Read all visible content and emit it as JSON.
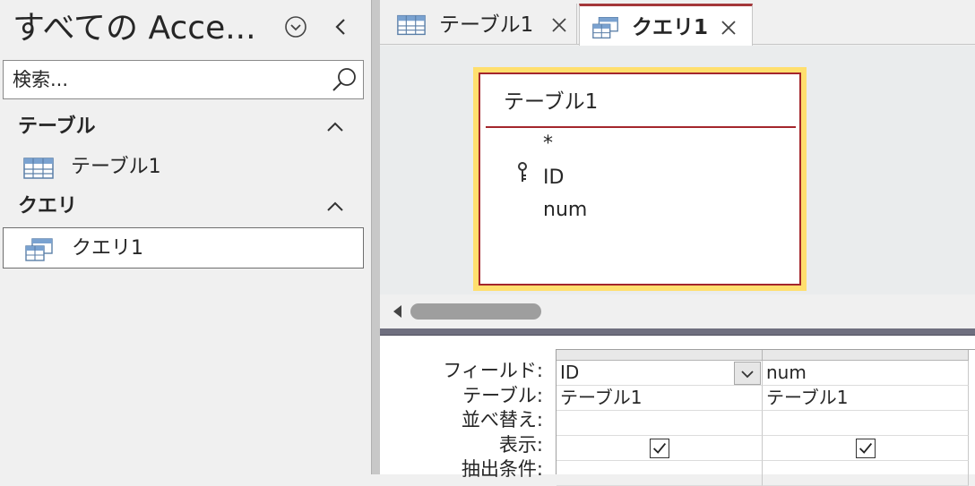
{
  "nav": {
    "title": "すべての Acce...",
    "search_placeholder": "検索...",
    "groups": [
      {
        "label": "テーブル",
        "items": [
          {
            "label": "テーブル1",
            "icon": "table-icon"
          }
        ]
      },
      {
        "label": "クエリ",
        "items": [
          {
            "label": "クエリ1",
            "icon": "query-icon",
            "selected": true
          }
        ]
      }
    ]
  },
  "tabs": [
    {
      "label": "テーブル1",
      "icon": "table-icon",
      "active": false
    },
    {
      "label": "クエリ1",
      "icon": "query-icon",
      "active": true
    }
  ],
  "table_box": {
    "title": "テーブル1",
    "fields": [
      "*",
      "ID",
      "num"
    ]
  },
  "grid": {
    "row_labels": [
      "フィールド:",
      "テーブル:",
      "並べ替え:",
      "表示:",
      "抽出条件:"
    ],
    "columns": [
      {
        "field": "ID",
        "table": "テーブル1",
        "sort": "",
        "show": true
      },
      {
        "field": "num",
        "table": "テーブル1",
        "sort": "",
        "show": true
      }
    ]
  },
  "colors": {
    "accent": "#a4373a",
    "table_border": "#a4262c",
    "selection_outline": "#ffdf6e",
    "splitter_bar": "#6f6f7f"
  }
}
